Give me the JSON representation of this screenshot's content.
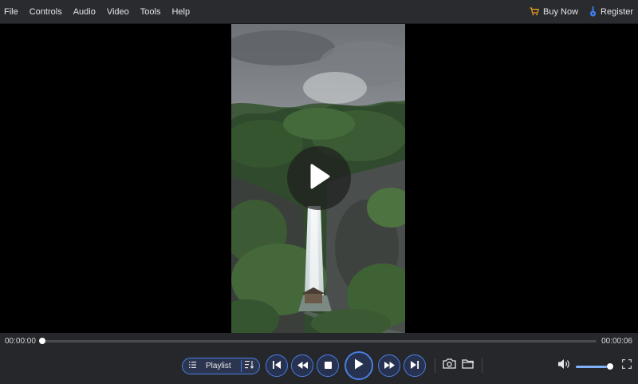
{
  "menu": {
    "items": [
      {
        "label": "File"
      },
      {
        "label": "Controls"
      },
      {
        "label": "Audio"
      },
      {
        "label": "Video"
      },
      {
        "label": "Tools"
      },
      {
        "label": "Help"
      }
    ],
    "buy_now": {
      "label": "Buy Now",
      "icon": "cart-icon"
    },
    "register": {
      "label": "Register",
      "icon": "key-icon"
    }
  },
  "player": {
    "overlay_icon": "play-icon",
    "time_current": "00:00:00",
    "time_total": "00:00:06",
    "progress": 0.0
  },
  "controls": {
    "playlist_label": "Playlist",
    "buttons": [
      "previous-icon",
      "rewind-icon",
      "stop-icon",
      "play-icon",
      "fast-forward-icon",
      "next-icon"
    ],
    "tools": [
      "snapshot-icon",
      "folder-icon"
    ],
    "volume_level": 0.85,
    "volume_icon": "volume-icon",
    "fullscreen_icon": "fullscreen-icon"
  },
  "colors": {
    "accent": "#4a7fe0",
    "buy_now_icon": "#f0a020",
    "register_icon": "#3d7ef0"
  }
}
